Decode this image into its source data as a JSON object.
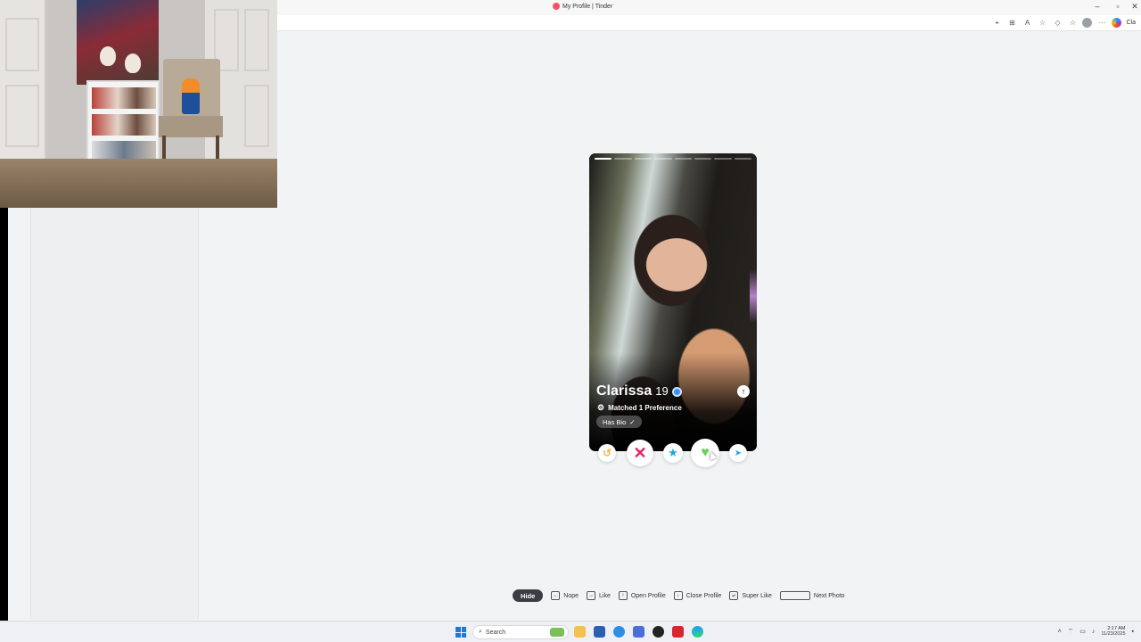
{
  "browser": {
    "tab_title": "My Profile | Tinder",
    "copilot_label": "Cla"
  },
  "card": {
    "name": "Clarissa",
    "age": "19",
    "matched": "Matched 1 Preference",
    "bio_badge": "Has Bio",
    "photo_count": 8,
    "active_photo": 1
  },
  "shortcuts": {
    "hide": "Hide",
    "nope": "Nope",
    "like": "Like",
    "open_profile": "Open Profile",
    "close_profile": "Close Profile",
    "super_like": "Super Like",
    "next_photo": "Next Photo"
  },
  "taskbar": {
    "search_placeholder": "Search",
    "time": "2:17 AM",
    "date": "11/23/2025"
  },
  "colors": {
    "nope": "#e91e63",
    "like": "#66d35b",
    "super_like": "#1fa6e8",
    "rewind": "#f5b748",
    "brand": "#fd5068"
  }
}
